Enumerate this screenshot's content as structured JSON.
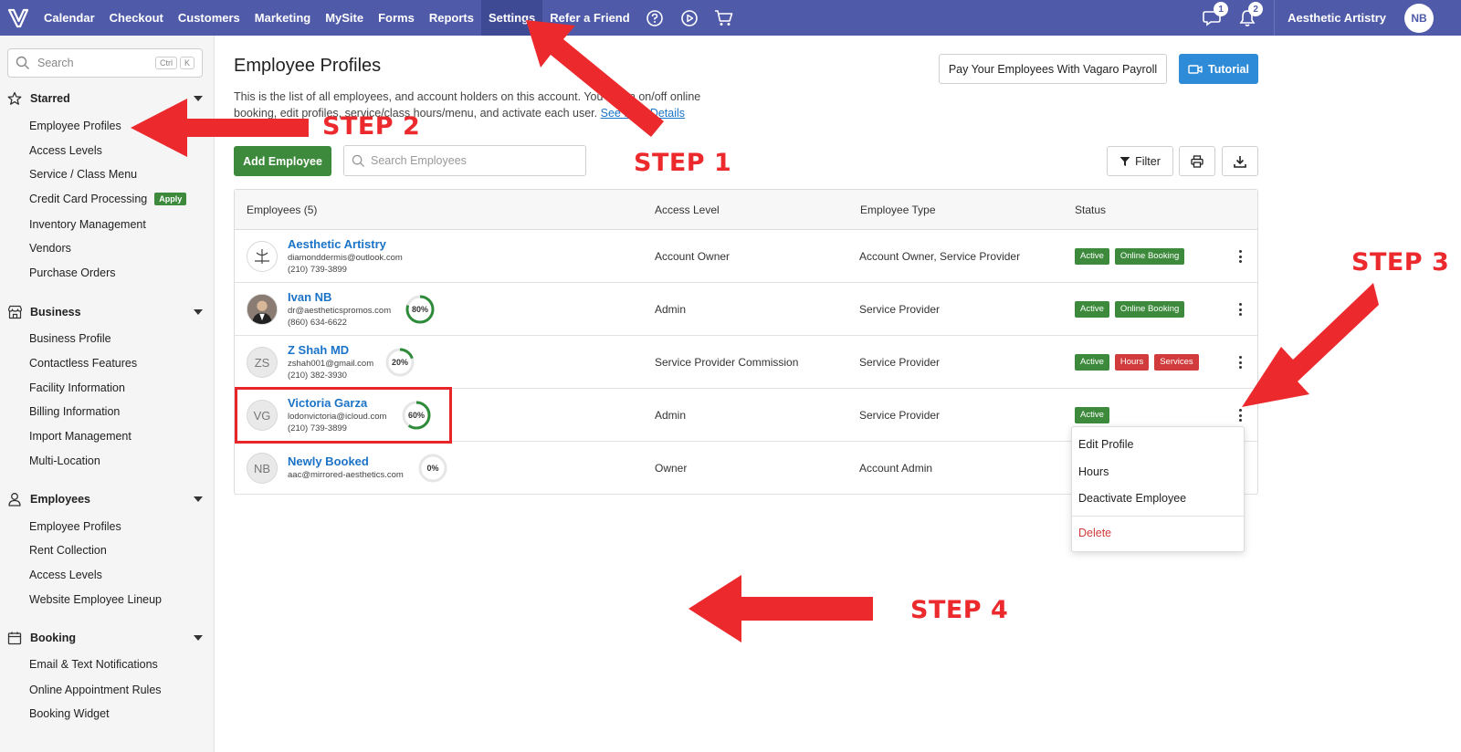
{
  "nav": {
    "items": [
      "Calendar",
      "Checkout",
      "Customers",
      "Marketing",
      "MySite",
      "Forms",
      "Reports",
      "Settings",
      "Refer a Friend"
    ],
    "active": "Settings",
    "messages_count": "1",
    "notifications_count": "2",
    "account_name": "Aesthetic Artistry",
    "avatar_initials": "NB"
  },
  "sidebar": {
    "search_placeholder": "Search",
    "shortcut": [
      "Ctrl",
      "K"
    ],
    "sections": [
      {
        "title": "Starred",
        "icon": "star-icon",
        "items": [
          "Employee Profiles",
          "Access Levels",
          "Service / Class Menu",
          "Credit Card Processing",
          "Inventory Management",
          "Vendors",
          "Purchase Orders"
        ]
      },
      {
        "title": "Business",
        "icon": "store-icon",
        "items": [
          "Business Profile",
          "Contactless Features",
          "Facility Information",
          "Billing Information",
          "Import Management",
          "Multi-Location"
        ]
      },
      {
        "title": "Employees",
        "icon": "person-icon",
        "items": [
          "Employee Profiles",
          "Rent Collection",
          "Access Levels",
          "Website Employee Lineup"
        ]
      },
      {
        "title": "Booking",
        "icon": "calendar-icon",
        "items": [
          "Email & Text Notifications",
          "Online Appointment Rules",
          "Booking Widget"
        ]
      }
    ],
    "apply_badge": "Apply"
  },
  "main": {
    "title": "Employee Profiles",
    "description_a": "This is the list of all employees, and account holders on this account. You",
    "description_b": "a turn on/off online",
    "description_c": "booking, edit profiles, service/class hours/menu, and activate each user.",
    "see_more_link": "See Plan Details",
    "payroll_button": "Pay Your Employees With Vagaro Payroll",
    "tutorial_button": "Tutorial",
    "add_button": "Add Employee",
    "search_placeholder": "Search Employees",
    "filter_button": "Filter"
  },
  "table": {
    "headers": [
      "Employees (5)",
      "Access Level",
      "Employee Type",
      "Status"
    ],
    "rows": [
      {
        "initials": "",
        "name": "Aesthetic Artistry",
        "email": "diamonddermis@outlook.com",
        "phone": "(210) 739-3899",
        "completion": "",
        "access": "Account Owner",
        "type": "Account Owner, Service Provider",
        "tags": [
          "Active",
          "Online Booking"
        ]
      },
      {
        "initials": "",
        "name": "Ivan NB",
        "email": "dr@aestheticspromos.com",
        "phone": "(860) 634-6622",
        "completion": "80%",
        "completion_value": 80,
        "access": "Admin",
        "type": "Service Provider",
        "tags": [
          "Active",
          "Online Booking"
        ]
      },
      {
        "initials": "ZS",
        "name": "Z Shah MD",
        "email": "zshah001@gmail.com",
        "phone": "(210) 382-3930",
        "completion": "20%",
        "completion_value": 20,
        "access": "Service Provider Commission",
        "type": "Service Provider",
        "tags": [
          "Active",
          "Hours",
          "Services"
        ]
      },
      {
        "initials": "VG",
        "name": "Victoria Garza",
        "email": "lodonvictoria@icloud.com",
        "phone": "(210) 739-3899",
        "completion": "60%",
        "completion_value": 60,
        "access": "Admin",
        "type": "Service Provider",
        "tags": [
          "Active"
        ]
      },
      {
        "initials": "NB",
        "name": "Newly Booked",
        "email": "aac@mirrored-aesthetics.com",
        "phone": "",
        "completion": "0%",
        "completion_value": 0,
        "access": "Owner",
        "type": "Account Admin",
        "tags": []
      }
    ]
  },
  "context_menu": {
    "items": [
      "Edit Profile",
      "Hours",
      "Deactivate Employee"
    ],
    "delete": "Delete"
  },
  "annotations": {
    "step1": "STEP 1",
    "step2": "STEP 2",
    "step3": "STEP 3",
    "step4": "STEP 4"
  },
  "colors": {
    "nav_bg": "#4f5aa8",
    "active_tag": "#3d8a3d",
    "warning_tag": "#d23b3b",
    "link": "#1a73c7",
    "annotation": "#ec2a2e",
    "progress": "#2e8b3a"
  }
}
